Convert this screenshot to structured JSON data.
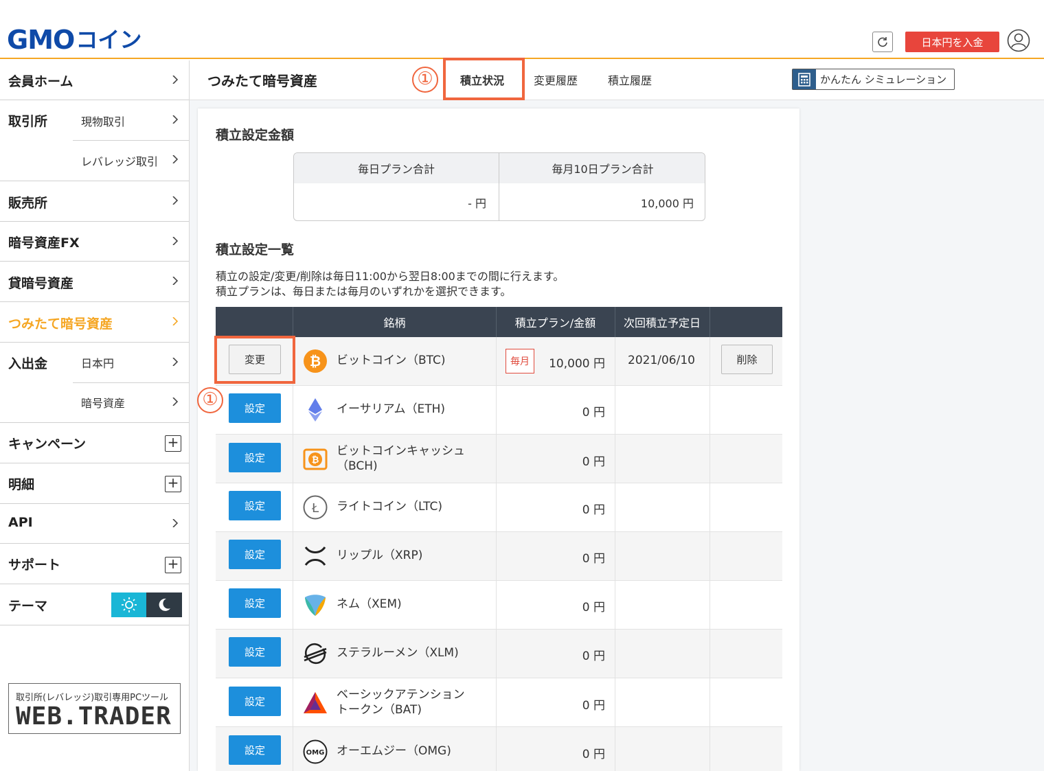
{
  "header": {
    "logo_gmo": "GMO",
    "logo_coin": "コイン",
    "deposit_label": "日本円を入金",
    "accent_color": "#f5a623"
  },
  "sidebar": {
    "items": [
      {
        "label": "会員ホーム"
      },
      {
        "label": "取引所",
        "subs": [
          "現物取引",
          "レバレッジ取引"
        ]
      },
      {
        "label": "販売所"
      },
      {
        "label": "暗号資産FX"
      },
      {
        "label": "貸暗号資産"
      },
      {
        "label": "つみたて暗号資産",
        "active": true
      },
      {
        "label": "入出金",
        "subs": [
          "日本円",
          "暗号資産"
        ]
      },
      {
        "label": "キャンペーン"
      },
      {
        "label": "明細"
      },
      {
        "label": "API"
      },
      {
        "label": "サポート"
      },
      {
        "label": "テーマ"
      }
    ],
    "webtrader_top": "取引所(レバレッジ)取引専用PCツール",
    "webtrader_main": "WEB.TRADER"
  },
  "subheader": {
    "title": "つみたて暗号資産",
    "tabs": [
      "積立状況",
      "変更履歴",
      "積立履歴"
    ],
    "simulation_label": "かんたん シミュレーション",
    "marker": "①"
  },
  "summary": {
    "section_title": "積立設定金額",
    "daily_header": "毎日プラン合計",
    "monthly_header": "毎月10日プラン合計",
    "daily_value": "- 円",
    "monthly_value": "10,000 円"
  },
  "list": {
    "section_title": "積立設定一覧",
    "note_line1": "積立の設定/変更/削除は毎日11:00から翌日8:00までの間に行えます。",
    "note_line2": "積立プランは、毎日または毎月のいずれかを選択できます。",
    "columns": [
      "",
      "銘柄",
      "積立プラン/金額",
      "次回積立予定日",
      ""
    ],
    "change_label": "変更",
    "set_label": "設定",
    "delete_label": "削除",
    "marker": "①",
    "rows": [
      {
        "name1": "ビットコイン（BTC)",
        "name2": "",
        "plan": "毎月",
        "amount": "10,000 円",
        "next": "2021/06/10",
        "icon": "btc-icon"
      },
      {
        "name1": "イーサリアム（ETH)",
        "name2": "",
        "amount": "0 円",
        "icon": "eth-icon"
      },
      {
        "name1": "ビットコインキャッシュ",
        "name2": "（BCH)",
        "amount": "0 円",
        "icon": "bch-icon"
      },
      {
        "name1": "ライトコイン（LTC)",
        "name2": "",
        "amount": "0 円",
        "icon": "ltc-icon"
      },
      {
        "name1": "リップル（XRP)",
        "name2": "",
        "amount": "0 円",
        "icon": "xrp-icon"
      },
      {
        "name1": "ネム（XEM)",
        "name2": "",
        "amount": "0 円",
        "icon": "xem-icon"
      },
      {
        "name1": "ステラルーメン（XLM)",
        "name2": "",
        "amount": "0 円",
        "icon": "xlm-icon"
      },
      {
        "name1": "ベーシックアテンション",
        "name2": "トークン（BAT)",
        "amount": "0 円",
        "icon": "bat-icon"
      },
      {
        "name1": "オーエムジー（OMG)",
        "name2": "",
        "amount": "0 円",
        "icon": "omg-icon"
      }
    ]
  }
}
